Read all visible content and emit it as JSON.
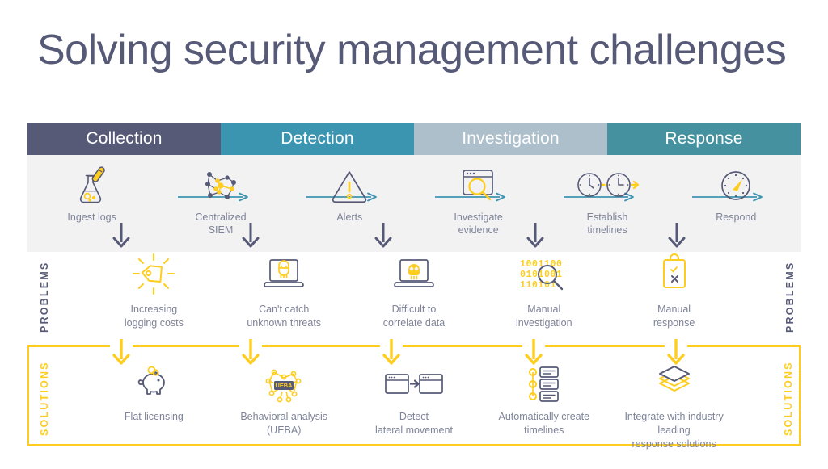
{
  "page": {
    "title": "Solving security management challenges",
    "background": "#ffffff"
  },
  "colors": {
    "slate": "#565a77",
    "teal": "#3c95b0",
    "teal_dark": "#45919f",
    "blue_grey": "#aebfcc",
    "yellow": "#ffcd1e",
    "row_bg": "#f2f2f2",
    "label_text": "#7d8398"
  },
  "stages": [
    {
      "label": "Collection",
      "color": "#565a77"
    },
    {
      "label": "Detection",
      "color": "#3c95b0"
    },
    {
      "label": "Investigation",
      "color": "#aebfcc"
    },
    {
      "label": "Response",
      "color": "#45919f"
    }
  ],
  "flow": {
    "steps": [
      {
        "label": "Ingest logs",
        "icon": "flask-dropper-icon"
      },
      {
        "label": "Centralized\nSIEM",
        "icon": "network-nodes-icon"
      },
      {
        "label": "Alerts",
        "icon": "warning-triangle-icon"
      },
      {
        "label": "Investigate\nevidence",
        "icon": "browser-magnifier-icon"
      },
      {
        "label": "Establish\ntimelines",
        "icon": "two-clocks-icon"
      },
      {
        "label": "Respond",
        "icon": "speedometer-icon"
      }
    ]
  },
  "problems": {
    "rail_label": "PROBLEMS",
    "items": [
      {
        "label": "Increasing\nlogging costs",
        "icon": "price-tag-rays-icon"
      },
      {
        "label": "Can't catch\nunknown threats",
        "icon": "laptop-masked-face-icon"
      },
      {
        "label": "Difficult to\ncorrelate data",
        "icon": "laptop-skull-icon"
      },
      {
        "label": "Manual\ninvestigation",
        "icon": "binary-magnifier-icon"
      },
      {
        "label": "Manual\nresponse",
        "icon": "clipboard-check-x-icon"
      }
    ]
  },
  "solutions": {
    "rail_label": "SOLUTIONS",
    "items": [
      {
        "label": "Flat licensing",
        "icon": "piggy-bank-icon"
      },
      {
        "label": "Behavioral analysis\n(UEBA)",
        "icon": "ueba-network-icon",
        "badge": "UEBA"
      },
      {
        "label": "Detect\nlateral movement",
        "icon": "windows-arrow-icon"
      },
      {
        "label": "Automatically create\ntimelines",
        "icon": "timeline-list-icon"
      },
      {
        "label": "Integrate with industry leading\nresponse solutions",
        "icon": "stacked-layers-icon"
      }
    ]
  }
}
